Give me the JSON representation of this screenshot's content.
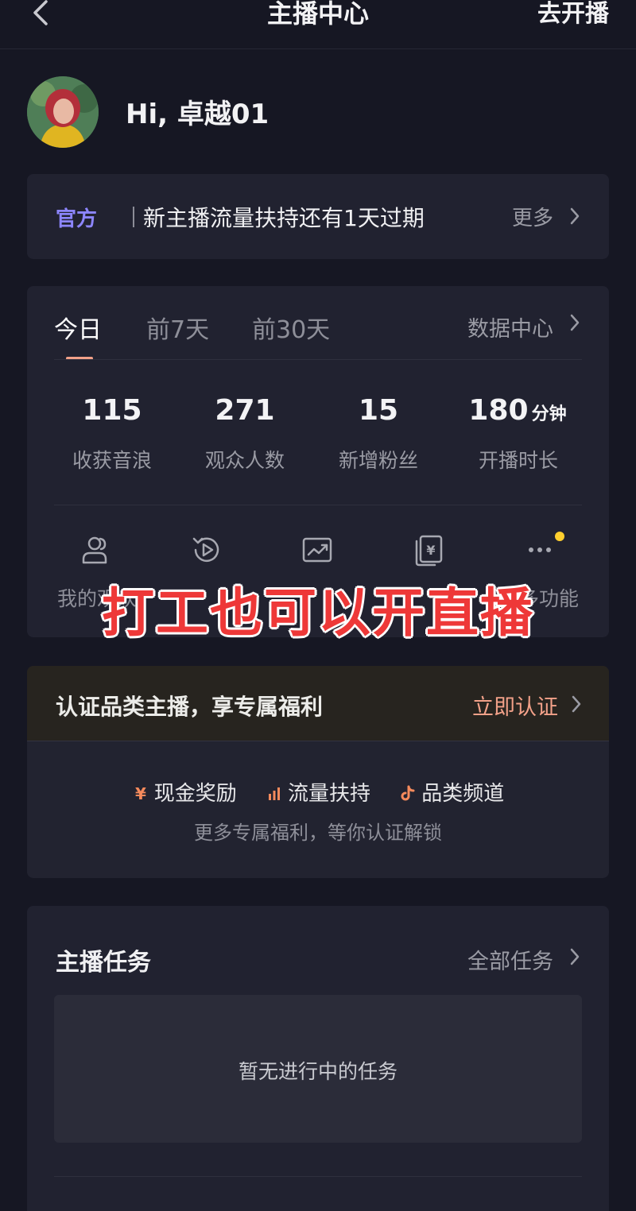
{
  "header": {
    "title": "主播中心",
    "action": "去开播"
  },
  "profile": {
    "greeting": "Hi, 卓越01"
  },
  "notice": {
    "tag": "官方",
    "text": "新主播流量扶持还有1天过期",
    "more": "更多"
  },
  "stats": {
    "tabs": [
      {
        "label": "今日"
      },
      {
        "label": "前7天"
      },
      {
        "label": "前30天"
      }
    ],
    "active_tab": "今日",
    "data_center": "数据中心",
    "metrics": [
      {
        "value": "115",
        "unit": "",
        "label": "收获音浪"
      },
      {
        "value": "271",
        "unit": "",
        "label": "观众人数"
      },
      {
        "value": "15",
        "unit": "",
        "label": "新增粉丝"
      },
      {
        "value": "180",
        "unit": "分钟",
        "label": "开播时长"
      }
    ],
    "functions": [
      {
        "icon": "audience-icon",
        "label": "我的观众"
      },
      {
        "icon": "replay-icon",
        "label": ""
      },
      {
        "icon": "chart-icon",
        "label": ""
      },
      {
        "icon": "wallet-icon",
        "label": ""
      },
      {
        "icon": "more-icon",
        "label": "更多功能"
      }
    ],
    "badge_color": "#ffcf2e"
  },
  "overlay": {
    "text": "打工也可以开直播"
  },
  "certification": {
    "title": "认证品类主播，享专属福利",
    "action": "立即认证",
    "perks": [
      {
        "icon": "yuan-icon",
        "label": "现金奖励"
      },
      {
        "icon": "bar-chart-icon",
        "label": "流量扶持"
      },
      {
        "icon": "tiktok-icon",
        "label": "品类频道"
      }
    ],
    "subtitle": "更多专属福利，等你认证解锁"
  },
  "tasks": {
    "title": "主播任务",
    "all": "全部任务",
    "empty": "暂无进行中的任务"
  },
  "colors": {
    "background": "#161723",
    "card": "#212230",
    "accent": "#f2a189",
    "official": "#8d86ff",
    "overlay": "#ee3838"
  }
}
